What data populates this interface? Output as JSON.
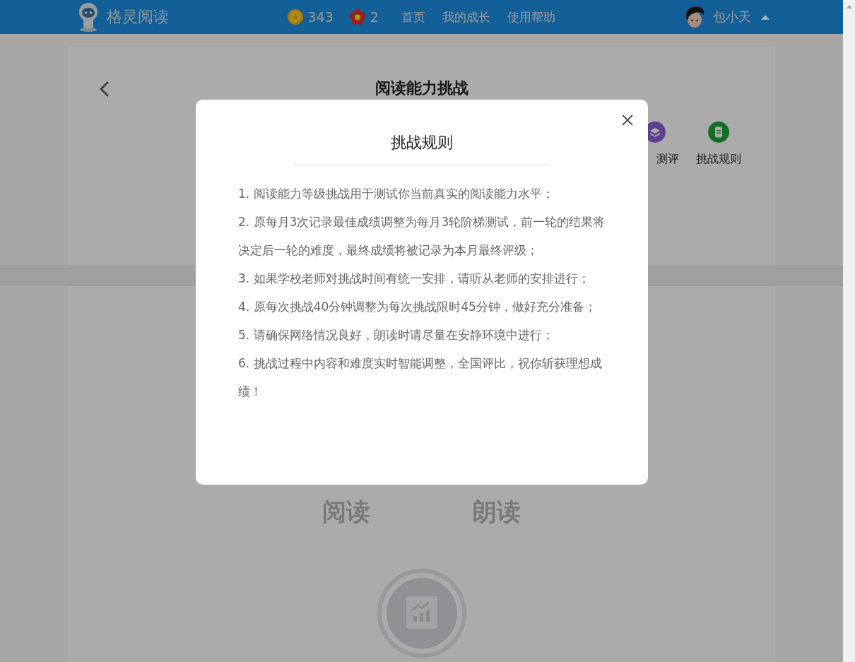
{
  "header": {
    "logo_text": "格灵阅读",
    "coins": "343",
    "flowers": "2",
    "nav": [
      {
        "label": "首页"
      },
      {
        "label": "我的成长"
      },
      {
        "label": "使用帮助"
      }
    ],
    "user": {
      "name": "包小天"
    }
  },
  "page": {
    "title": "阅读能力挑战",
    "tools": [
      {
        "label": "测评",
        "kind": "assess"
      },
      {
        "label": "挑战规则",
        "kind": "rules"
      }
    ],
    "modes": [
      {
        "label": "阅读"
      },
      {
        "label": "朗读"
      }
    ]
  },
  "dialog": {
    "title": "挑战规则",
    "rules": [
      "1. 阅读能力等级挑战用于测试你当前真实的阅读能力水平；",
      "2. 原每月3次记录最佳成绩调整为每月3轮阶梯测试，前一轮的结果将决定后一轮的难度，最终成绩将被记录为本月最终评级；",
      "3. 如果学校老师对挑战时间有统一安排，请听从老师的安排进行；",
      "4. 原每次挑战40分钟调整为每次挑战限时45分钟，做好充分准备；",
      "5. 请确保网络情况良好，朗读时请尽量在安静环境中进行；",
      "6. 挑战过程中内容和难度实时智能调整，全国评比，祝你斩获理想成绩！"
    ]
  }
}
